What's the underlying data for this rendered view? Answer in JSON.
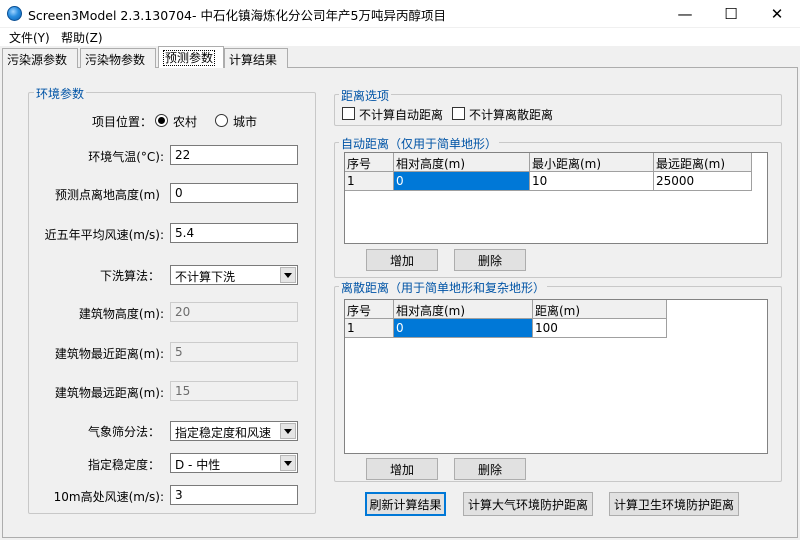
{
  "window": {
    "title": "Screen3Model 2.3.130704- 中石化镇海炼化分公司年产5万吨异丙醇项目",
    "min_glyph": "—",
    "max_glyph": "☐",
    "close_glyph": "✕"
  },
  "menu": {
    "file": "文件(Y)",
    "help": "帮助(Z)"
  },
  "tabs": [
    {
      "label": "污染源参数"
    },
    {
      "label": "污染物参数"
    },
    {
      "label": "预测参数"
    },
    {
      "label": "计算结果"
    }
  ],
  "env": {
    "group_title": "环境参数",
    "location_label": "项目位置：",
    "location_options": [
      "农村",
      "城市"
    ],
    "location_selected": "农村",
    "temp_label": "环境气温(°C):",
    "temp_value": "22",
    "height_label": "预测点离地高度(m)",
    "height_value": "0",
    "wind_label": "近五年平均风速(m/s):",
    "wind_value": "5.4",
    "downwash_label": "下洗算法：",
    "downwash_value": "不计算下洗",
    "bldg_height_label": "建筑物高度(m):",
    "bldg_height_value": "20",
    "bldg_near_label": "建筑物最近距离(m):",
    "bldg_near_value": "5",
    "bldg_far_label": "建筑物最远距离(m):",
    "bldg_far_value": "15",
    "met_label": "气象筛分法：",
    "met_value": "指定稳定度和风速",
    "stability_label": "指定稳定度：",
    "stability_value": "D - 中性",
    "wind10_label": "10m高处风速(m/s):",
    "wind10_value": "3"
  },
  "dist_options": {
    "group_title": "距离选项",
    "no_auto": "不计算自动距离",
    "no_discrete": "不计算离散距离"
  },
  "auto_dist": {
    "group_title": "自动距离（仅用于简单地形）",
    "headers": [
      "序号",
      "相对高度(m)",
      "最小距离(m)",
      "最远距离(m)"
    ],
    "rows": [
      [
        "1",
        "0",
        "10",
        "25000"
      ]
    ],
    "add_label": "增加",
    "delete_label": "删除"
  },
  "discrete_dist": {
    "group_title": "离散距离（用于简单地形和复杂地形）",
    "headers": [
      "序号",
      "相对高度(m)",
      "距离(m)"
    ],
    "rows": [
      [
        "1",
        "0",
        "100"
      ]
    ],
    "add_label": "增加",
    "delete_label": "删除"
  },
  "actions": {
    "refresh": "刷新计算结果",
    "atmos": "计算大气环境防护距离",
    "health": "计算卫生环境防护距离"
  }
}
